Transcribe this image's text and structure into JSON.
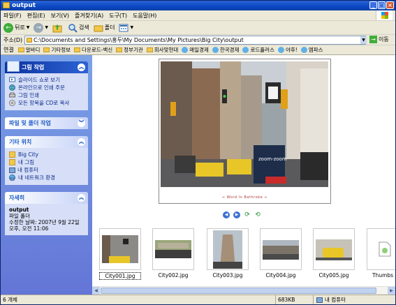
{
  "window": {
    "title": "output"
  },
  "menu": [
    "파일(F)",
    "편집(E)",
    "보기(V)",
    "즐겨찾기(A)",
    "도구(T)",
    "도움말(H)"
  ],
  "toolbar": {
    "back": "뒤로",
    "search": "검색",
    "folders": "폴더"
  },
  "address": {
    "label": "주소(D)",
    "path": "C:\\Documents and Settings\\홍두\\My Documents\\My Pictures\\Big City\\output",
    "go": "이동"
  },
  "links": {
    "label": "연결",
    "items": [
      "알바디",
      "기타정보",
      "다운로드-백신",
      "정부기관",
      "회사맞현대",
      "매일경제",
      "한국경제",
      "로드플러스",
      "야후!",
      "엠파스"
    ]
  },
  "sidebar": {
    "picture_tasks": {
      "title": "그림 작업",
      "items": [
        "슬라이드 쇼로 보기",
        "온라인으로 인쇄 주문",
        "그림 인쇄",
        "모든 항목을 CD로 복사"
      ]
    },
    "file_tasks": {
      "title": "파일 및 폴더 작업"
    },
    "other_places": {
      "title": "기타 위치",
      "items": [
        "Big City",
        "내 그림",
        "내 컴퓨터",
        "내 네트워크 환경"
      ]
    },
    "details": {
      "title": "자세히",
      "name": "output",
      "type": "파일 폴더",
      "modified": "수정한 날짜: 2007년 9월 22일 오후, 오전 11:06"
    }
  },
  "preview": {
    "sign_text": "zoom-zoom",
    "caption": "≈ Word In Bathrobe ≈"
  },
  "thumbnails": [
    {
      "label": "City001.jpg",
      "selected": true
    },
    {
      "label": "City002.jpg",
      "selected": false
    },
    {
      "label": "City003.jpg",
      "selected": false
    },
    {
      "label": "City004.jpg",
      "selected": false
    },
    {
      "label": "City005.jpg",
      "selected": false
    },
    {
      "label": "Thumbs",
      "selected": false
    }
  ],
  "status": {
    "count": "6 개체",
    "size": "683KB",
    "location": "내 컴퓨터"
  },
  "colors": {
    "title_bar": "#0b47c1",
    "sidebar_bg": "#7ba2e7",
    "link_blue": "#0c2a8a"
  }
}
